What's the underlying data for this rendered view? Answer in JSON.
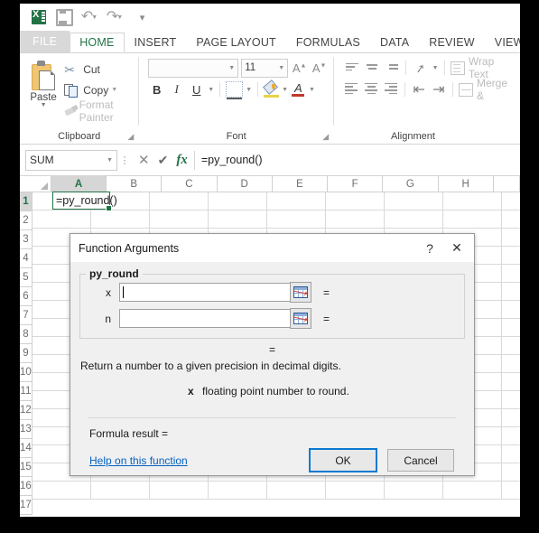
{
  "quick_access": {
    "app_icon": "excel-logo-icon",
    "items": [
      {
        "name": "save-icon",
        "label": "Save"
      },
      {
        "name": "undo-icon",
        "label": "Undo"
      },
      {
        "name": "redo-icon",
        "label": "Redo"
      },
      {
        "name": "customize-qat-icon",
        "label": "Customize Quick Access Toolbar"
      }
    ]
  },
  "ribbon": {
    "tabs": [
      {
        "label": "FILE",
        "state": "file"
      },
      {
        "label": "HOME",
        "state": "active"
      },
      {
        "label": "INSERT",
        "state": "normal"
      },
      {
        "label": "PAGE LAYOUT",
        "state": "normal"
      },
      {
        "label": "FORMULAS",
        "state": "normal"
      },
      {
        "label": "DATA",
        "state": "normal"
      },
      {
        "label": "REVIEW",
        "state": "normal"
      },
      {
        "label": "VIEW",
        "state": "normal"
      }
    ],
    "clipboard": {
      "group_label": "Clipboard",
      "paste_label": "Paste",
      "cut_label": "Cut",
      "copy_label": "Copy",
      "format_painter_label": "Format Painter"
    },
    "font": {
      "group_label": "Font",
      "font_name": "",
      "font_size": "11",
      "bold_label": "B",
      "italic_label": "I",
      "underline_label": "U"
    },
    "alignment": {
      "group_label": "Alignment",
      "wrap_text_label": "Wrap Text",
      "merge_label": "Merge &"
    }
  },
  "formula_bar": {
    "name_box": "SUM",
    "cancel_label": "✕",
    "enter_label": "✔",
    "function_label": "fx",
    "formula": "=py_round()"
  },
  "sheet": {
    "columns": [
      "A",
      "B",
      "C",
      "D",
      "E",
      "F",
      "G",
      "H"
    ],
    "selected_column": "A",
    "rows": [
      "1",
      "2",
      "3",
      "4",
      "5",
      "6",
      "7",
      "8",
      "9",
      "10",
      "11",
      "12",
      "13",
      "14",
      "15",
      "16",
      "17"
    ],
    "selected_row": "1",
    "active_cell_value": "=py_round()"
  },
  "dialog": {
    "title": "Function Arguments",
    "help_button": "?",
    "close_button": "✕",
    "function_name": "py_round",
    "arguments": [
      {
        "label": "x",
        "value": "",
        "equals": "=",
        "range_icon": "range-selector-icon"
      },
      {
        "label": "n",
        "value": "",
        "equals": "=",
        "range_icon": "range-selector-icon"
      }
    ],
    "result_equals": "=",
    "description": "Return a number to a given precision in decimal digits.",
    "arg_help_name": "x",
    "arg_help_text": "floating point number to round.",
    "formula_result_label": "Formula result =",
    "formula_result_value": "",
    "help_link": "Help on this function",
    "ok_label": "OK",
    "cancel_label": "Cancel"
  },
  "colors": {
    "excel_green": "#217346",
    "link_blue": "#0563c1",
    "focus_blue": "#0a7ad1"
  }
}
